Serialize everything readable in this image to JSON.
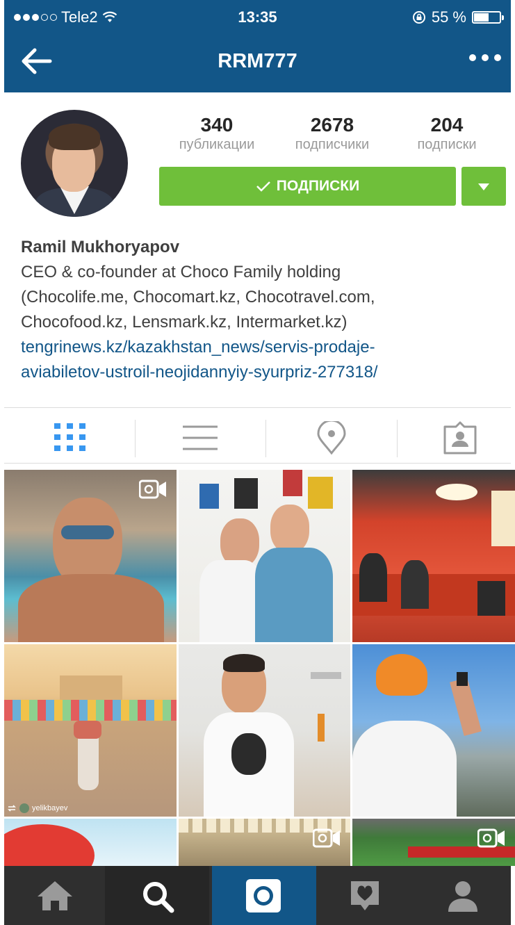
{
  "status": {
    "carrier": "Tele2",
    "time": "13:35",
    "battery": "55 %"
  },
  "nav": {
    "title": "RRM777"
  },
  "profile": {
    "stats": [
      {
        "num": "340",
        "label": "публикации"
      },
      {
        "num": "2678",
        "label": "подписчики"
      },
      {
        "num": "204",
        "label": "подписки"
      }
    ],
    "follow_label": "ПОДПИСКИ",
    "name": "Ramil Mukhoryapov",
    "bio_lines": [
      "CEO & co-founder at Choco Family holding",
      "(Chocolife.me, Chocomart.kz, Chocotravel.com,",
      "Chocofood.kz, Lensmark.kz, Intermarket.kz)"
    ],
    "link_lines": [
      "tengrinews.kz/kazakhstan_news/servis-prodaje-",
      "aviabiletov-ustroil-neojidannyiy-syurpriz-277318/"
    ]
  },
  "tabs": [
    "grid-icon",
    "list-icon",
    "location-icon",
    "tagged-icon"
  ],
  "grid_tag": "yelikbayev",
  "colors": {
    "brand": "#125688",
    "follow": "#6fbf3a",
    "bottom": "#2f2f2f"
  }
}
